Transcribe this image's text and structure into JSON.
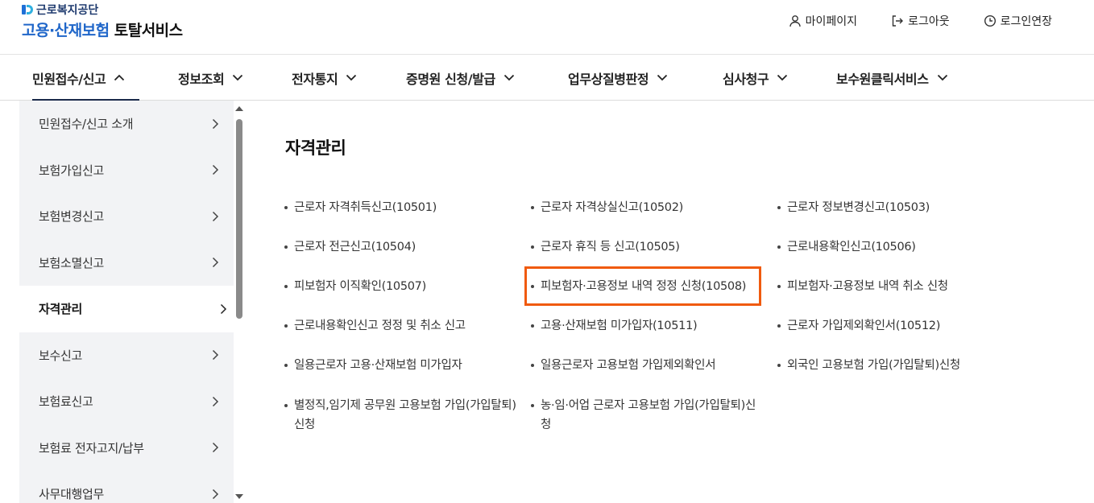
{
  "header": {
    "org_name": "근로복지공단",
    "service_name_part1": "고용·산재보험",
    "service_name_part2": "토탈서비스",
    "util": [
      {
        "label": "마이페이지",
        "icon": "person-icon"
      },
      {
        "label": "로그아웃",
        "icon": "logout-icon"
      },
      {
        "label": "로그인연장",
        "icon": "clock-icon"
      }
    ]
  },
  "gnb": {
    "items": [
      {
        "label": "민원접수/신고",
        "active": true
      },
      {
        "label": "정보조회"
      },
      {
        "label": "전자통지"
      },
      {
        "label": "증명원 신청/발급"
      },
      {
        "label": "업무상질병판정"
      },
      {
        "label": "심사청구"
      },
      {
        "label": "보수원클릭서비스"
      }
    ]
  },
  "sidebar": {
    "items": [
      {
        "label": "민원접수/신고 소개"
      },
      {
        "label": "보험가입신고"
      },
      {
        "label": "보험변경신고"
      },
      {
        "label": "보험소멸신고"
      },
      {
        "label": "자격관리",
        "active": true
      },
      {
        "label": "보수신고"
      },
      {
        "label": "보험료신고"
      },
      {
        "label": "보험료 전자고지/납부"
      },
      {
        "label": "사무대행업무"
      }
    ]
  },
  "main": {
    "title": "자격관리",
    "links": [
      {
        "label": "근로자 자격취득신고(10501)"
      },
      {
        "label": "근로자 자격상실신고(10502)"
      },
      {
        "label": "근로자 정보변경신고(10503)"
      },
      {
        "label": "근로자 전근신고(10504)"
      },
      {
        "label": "근로자 휴직 등 신고(10505)"
      },
      {
        "label": "근로내용확인신고(10506)"
      },
      {
        "label": "피보험자 이직확인(10507)"
      },
      {
        "label": "피보험자·고용정보 내역 정정 신청(10508)",
        "highlighted": true
      },
      {
        "label": "피보험자·고용정보 내역 취소 신청"
      },
      {
        "label": "근로내용확인신고 정정 및 취소 신고"
      },
      {
        "label": "고용·산재보험 미가입자(10511)"
      },
      {
        "label": "근로자 가입제외확인서(10512)"
      },
      {
        "label": "일용근로자 고용·산재보험 미가입자"
      },
      {
        "label": "일용근로자 고용보험 가입제외확인서"
      },
      {
        "label": "외국인 고용보험 가입(가입탈퇴)신청"
      },
      {
        "label": "별정직,임기제 공무원 고용보험 가입(가입탈퇴)신청"
      },
      {
        "label": "농·임·어업 근로자 고용보험 가입(가입탈퇴)신청"
      }
    ]
  },
  "colors": {
    "brand_blue": "#1f66c9",
    "highlight_border": "#f05a0e",
    "sidebar_bg": "#f2f3f5"
  }
}
